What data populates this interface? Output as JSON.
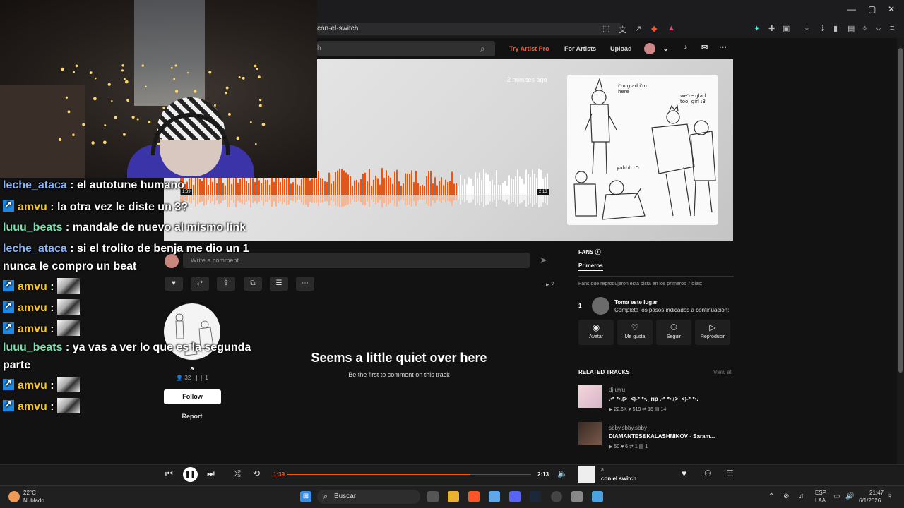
{
  "browser": {
    "url_text": "con-el-switch",
    "search_placeholder": "h"
  },
  "header": {
    "try_pro": "Try Artist Pro",
    "for_artists": "For Artists",
    "upload": "Upload"
  },
  "hero": {
    "time_ago": "2 minutes ago",
    "waveform_start": "1:39",
    "waveform_end": "2:13",
    "played_fraction": 0.75,
    "art_text_1": "i'm glad i'm here",
    "art_text_2": "we're glad too, girl :3",
    "art_text_3": "yahhh :D"
  },
  "chat": [
    {
      "user": "leche_ataca",
      "sep": " : ",
      "msg": "el autotune humano",
      "color": "blue",
      "badge": false,
      "emote": false
    },
    {
      "user": "amvu",
      "sep": " : ",
      "msg": "la otra vez le diste un 3?",
      "color": "yellow",
      "badge": true,
      "emote": false
    },
    {
      "user": "luuu_beats",
      "sep": " : ",
      "msg": "mandale de nuevo al mismo link",
      "color": "green",
      "badge": false,
      "emote": false
    },
    {
      "user": "leche_ataca",
      "sep": " : ",
      "msg": "si el trolito de benja me dio un 1",
      "msg2": "nunca le compro un beat",
      "color": "blue",
      "badge": false,
      "emote": false
    },
    {
      "user": "amvu",
      "sep": " :",
      "msg": "",
      "color": "yellow",
      "badge": true,
      "emote": true
    },
    {
      "user": "amvu",
      "sep": " :",
      "msg": "",
      "color": "yellow",
      "badge": true,
      "emote": true
    },
    {
      "user": "amvu",
      "sep": " :",
      "msg": "",
      "color": "yellow",
      "badge": true,
      "emote": true
    },
    {
      "user": "luuu_beats",
      "sep": " : ",
      "msg": "ya vas a ver lo que es la segunda",
      "msg2": "parte",
      "color": "green",
      "badge": false,
      "emote": false
    },
    {
      "user": "amvu",
      "sep": " :",
      "msg": "",
      "color": "yellow",
      "badge": true,
      "emote": true
    },
    {
      "user": "amvu",
      "sep": " :",
      "msg": "",
      "color": "yellow",
      "badge": true,
      "emote": true
    }
  ],
  "comment": {
    "placeholder": "Write a comment",
    "plays": "2"
  },
  "uploader": {
    "name": "a",
    "followers": "32",
    "tracks": "1",
    "follow_label": "Follow",
    "report_label": "Report"
  },
  "empty": {
    "title": "Seems a little quiet over here",
    "subtitle": "Be the first to comment on this track"
  },
  "fans": {
    "title": "FANS",
    "tab": "Primeros",
    "desc": "Fans que reprodujeron esta pista en los primeros 7 días:",
    "rank": "1",
    "spot_title": "Toma este lugar",
    "spot_sub": "Completa los pasos indicados a continuación:",
    "buttons": [
      "Avatar",
      "Me gusta",
      "Seguir",
      "Reproducir"
    ]
  },
  "related": {
    "title": "RELATED TRACKS",
    "view_all": "View all",
    "items": [
      {
        "artist": "dj uwu",
        "track": ".•*¨*•.(>_<)-*¨*•.¸ rip .•*¨*•.(>_<)-*¨*•.",
        "plays": "22.6K",
        "likes": "519",
        "reposts": "16",
        "comments": "14"
      },
      {
        "artist": "sbby.sbby.sbby",
        "track": "DIAMANTES&KALASHNIKOV - Saram...",
        "plays": "50",
        "likes": "6",
        "reposts": "1",
        "comments": "1"
      }
    ]
  },
  "player": {
    "elapsed": "1:39",
    "duration": "2:13",
    "progress_fraction": 0.75,
    "user": "a",
    "track": "con el switch"
  },
  "taskbar": {
    "weather_temp": "22°C",
    "weather_desc": "Nublado",
    "search": "Buscar",
    "lang_1": "ESP",
    "lang_2": "LAA",
    "time": "21:47",
    "date": "6/1/2026"
  },
  "colors": {
    "accent": "#ff5500",
    "background": "#121212"
  }
}
